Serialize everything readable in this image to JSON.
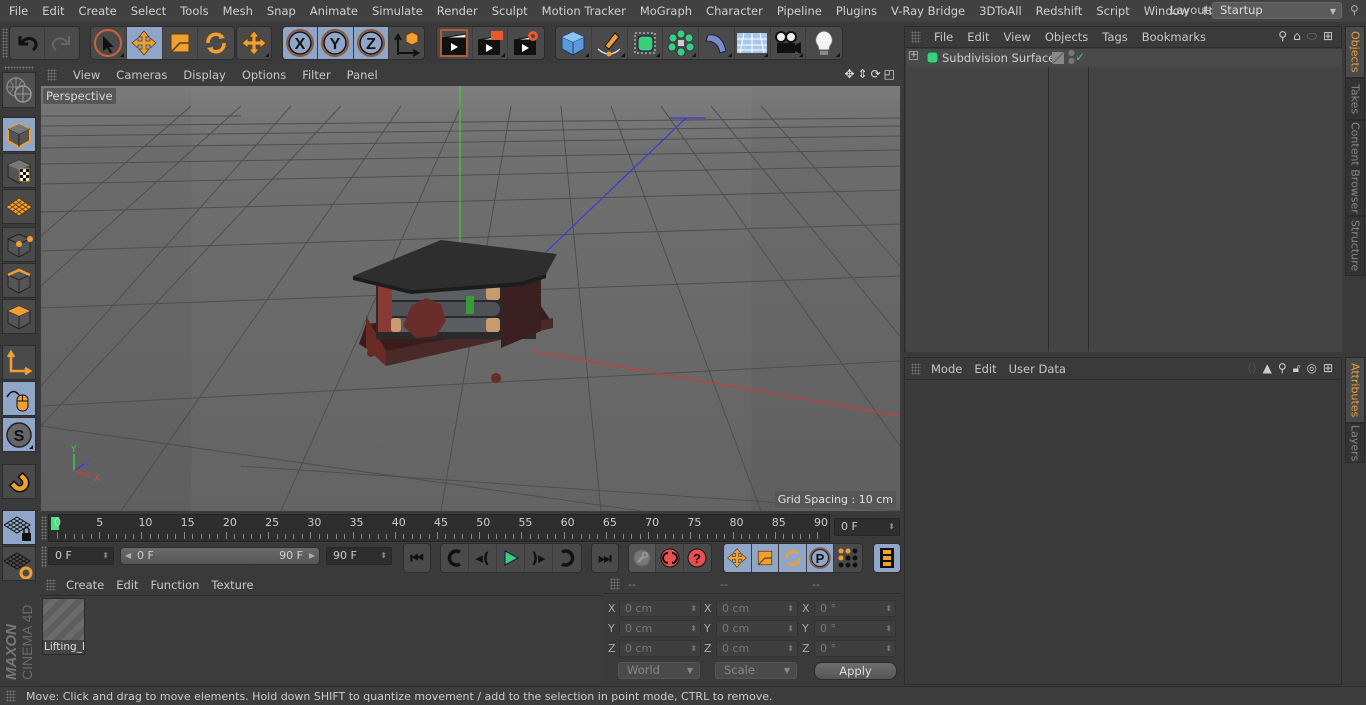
{
  "menubar": {
    "items": [
      "File",
      "Edit",
      "Create",
      "Select",
      "Tools",
      "Mesh",
      "Snap",
      "Animate",
      "Simulate",
      "Render",
      "Sculpt",
      "Motion Tracker",
      "MoGraph",
      "Character",
      "Pipeline",
      "Plugins",
      "V-Ray Bridge",
      "3DToAll",
      "Redshift",
      "Script",
      "Window",
      "Help"
    ],
    "layout_label": "Layout:",
    "layout_value": "Startup"
  },
  "toolbar": {
    "groups": [
      {
        "name": "history",
        "buttons": [
          {
            "icon": "undo-icon",
            "active": false
          },
          {
            "icon": "redo-icon",
            "active": false
          }
        ]
      },
      {
        "name": "transform",
        "buttons": [
          {
            "icon": "select-arrow-icon",
            "active": false
          },
          {
            "icon": "move-icon",
            "active": true
          },
          {
            "icon": "scale-icon",
            "active": false
          },
          {
            "icon": "rotate-icon",
            "active": false
          }
        ]
      },
      {
        "name": "recent",
        "buttons": [
          {
            "icon": "move-icon",
            "active": false
          }
        ]
      },
      {
        "name": "axis-lock",
        "buttons": [
          {
            "icon": "x-axis-icon",
            "label": "X",
            "active": true
          },
          {
            "icon": "y-axis-icon",
            "label": "Y",
            "active": true
          },
          {
            "icon": "z-axis-icon",
            "label": "Z",
            "active": true
          },
          {
            "icon": "coordinate-system-icon",
            "active": false
          }
        ]
      },
      {
        "name": "render",
        "buttons": [
          {
            "icon": "render-view-icon"
          },
          {
            "icon": "render-picture-viewer-icon"
          },
          {
            "icon": "render-settings-icon"
          }
        ]
      },
      {
        "name": "create",
        "buttons": [
          {
            "icon": "cube-icon"
          },
          {
            "icon": "pen-spline-icon"
          },
          {
            "icon": "subdivision-icon"
          },
          {
            "icon": "cloner-icon"
          },
          {
            "icon": "deformer-bend-icon"
          },
          {
            "icon": "floor-icon"
          },
          {
            "icon": "camera-icon"
          },
          {
            "icon": "light-icon"
          }
        ]
      }
    ]
  },
  "left_toolbar": {
    "buttons": [
      {
        "icon": "model-mode-icon",
        "active": true
      },
      {
        "icon": "texture-mode-icon",
        "active": false
      },
      {
        "icon": "workplane-mode-icon",
        "active": false
      },
      {
        "icon": "points-mode-icon",
        "active": false
      },
      {
        "icon": "edges-mode-icon",
        "active": false
      },
      {
        "icon": "polygons-mode-icon",
        "active": false
      },
      {
        "icon": "axis-mode-icon",
        "active": false
      },
      {
        "icon": "tweak-mode-icon",
        "active": true
      },
      {
        "icon": "solo-mode-icon",
        "active": true
      },
      {
        "icon": "snap-magnet-icon",
        "active": false
      },
      {
        "icon": "workplane-lock-icon",
        "active": true
      },
      {
        "icon": "workplane-align-icon",
        "active": false
      }
    ],
    "brand_top": "MAXON",
    "brand_bottom": "CINEMA 4D"
  },
  "viewport": {
    "menu": [
      "View",
      "Cameras",
      "Display",
      "Options",
      "Filter",
      "Panel"
    ],
    "camera_label": "Perspective",
    "grid_spacing": "Grid Spacing : 10 cm",
    "axis_labels": {
      "x": "X",
      "y": "Y",
      "z": "Z"
    },
    "nav_icons": [
      "pan-icon",
      "dolly-icon",
      "orbit-icon",
      "maximize-view-icon"
    ]
  },
  "timeline": {
    "ticks": [
      "0",
      "5",
      "10",
      "15",
      "20",
      "25",
      "30",
      "35",
      "40",
      "45",
      "50",
      "55",
      "60",
      "65",
      "70",
      "75",
      "80",
      "85",
      "90"
    ],
    "current_frame": "0 F",
    "start_field": "0 F",
    "range_start": "0 F",
    "range_end": "90 F",
    "end_field": "90 F",
    "playhead_frame": 0
  },
  "transport": {
    "buttons": [
      {
        "icon": "go-to-start-icon"
      },
      {
        "icon": "previous-key-icon"
      },
      {
        "icon": "previous-frame-icon"
      },
      {
        "icon": "play-icon"
      },
      {
        "icon": "next-frame-icon"
      },
      {
        "icon": "next-key-icon"
      },
      {
        "icon": "go-to-end-icon"
      }
    ],
    "key_buttons": [
      {
        "icon": "motion-record-icon"
      },
      {
        "icon": "autokey-icon"
      },
      {
        "icon": "keyframe-selection-icon"
      }
    ],
    "track_buttons": [
      {
        "icon": "key-position-icon",
        "active": true
      },
      {
        "icon": "key-scale-icon",
        "active": true
      },
      {
        "icon": "key-rotation-icon",
        "active": true
      },
      {
        "icon": "key-param-icon",
        "label": "P",
        "active": true
      },
      {
        "icon": "key-pla-icon",
        "active": false
      }
    ],
    "timeline_button": {
      "icon": "timeline-window-icon",
      "active": true
    }
  },
  "materials": {
    "menu": [
      "Create",
      "Edit",
      "Function",
      "Texture"
    ],
    "items": [
      {
        "name": "Lifting_Platform"
      }
    ],
    "visible_label": "Lifting_I"
  },
  "coordinates": {
    "headers": [
      "--",
      "--",
      "--"
    ],
    "rows": [
      {
        "axis": "X",
        "pos": "0 cm",
        "size": "0 cm",
        "rot": "0 °"
      },
      {
        "axis": "Y",
        "pos": "0 cm",
        "size": "0 cm",
        "rot": "0 °"
      },
      {
        "axis": "Z",
        "pos": "0 cm",
        "size": "0 cm",
        "rot": "0 °"
      }
    ],
    "mode_dropdown": "World",
    "size_dropdown": "Scale",
    "apply_label": "Apply"
  },
  "objects_panel": {
    "menu": [
      "File",
      "Edit",
      "View",
      "Objects",
      "Tags",
      "Bookmarks"
    ],
    "objects": [
      {
        "name": "Subdivision Surface",
        "expanded": false,
        "enabled": true
      }
    ],
    "icons": [
      "search-icon",
      "home-icon",
      "layer-icon",
      "new-panel-icon"
    ]
  },
  "attributes_panel": {
    "menu": [
      "Mode",
      "Edit",
      "User Data"
    ],
    "icons": [
      "back-icon",
      "cursor-icon",
      "search-icon",
      "lock-icon",
      "target-icon",
      "new-panel-icon"
    ]
  },
  "side_tabs": {
    "top": [
      {
        "label": "Objects",
        "active": true
      },
      {
        "label": "Takes",
        "active": false
      },
      {
        "label": "Content Browser",
        "active": false
      },
      {
        "label": "Structure",
        "active": false
      }
    ],
    "bottom": [
      {
        "label": "Attributes",
        "active": true
      },
      {
        "label": "Layers",
        "active": false
      }
    ]
  },
  "statusbar": {
    "text": "Move: Click and drag to move elements. Hold down SHIFT to quantize movement / add to the selection in point mode, CTRL to remove."
  },
  "colors": {
    "accent_orange": "#f0a030",
    "active_button": "#8fa6c9",
    "playhead": "#4bdf86",
    "tab_active_text": "#e8a23a",
    "axis_x": "#c83c3c",
    "axis_y": "#3cc83c",
    "axis_z": "#3c3cd0"
  }
}
